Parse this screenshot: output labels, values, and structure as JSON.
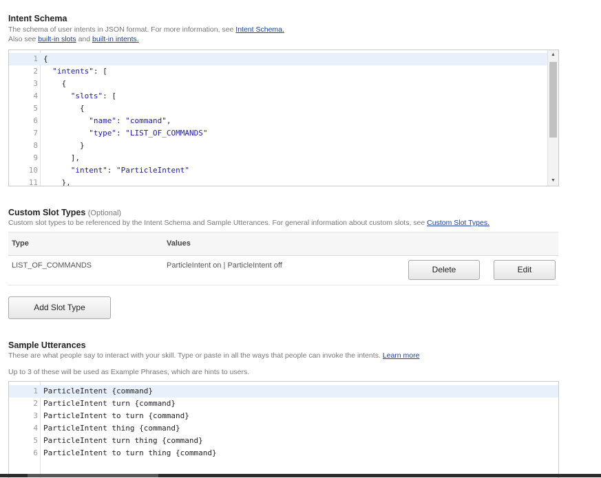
{
  "intent_schema": {
    "title": "Intent Schema",
    "desc_line1_prefix": "The schema of user intents in JSON format. For more information, see ",
    "desc_link1": "Intent Schema.",
    "desc_line2_prefix": "Also see ",
    "desc_link2": "built-in slots",
    "desc_and": " and ",
    "desc_link3": "built-in intents.",
    "editor_lines": [
      {
        "n": "1",
        "parts": [
          [
            "p",
            "{"
          ]
        ]
      },
      {
        "n": "2",
        "parts": [
          [
            "p",
            "  "
          ],
          [
            "s",
            "\"intents\""
          ],
          [
            "p",
            ": ["
          ]
        ]
      },
      {
        "n": "3",
        "parts": [
          [
            "p",
            "    {"
          ]
        ]
      },
      {
        "n": "4",
        "parts": [
          [
            "p",
            "      "
          ],
          [
            "s",
            "\"slots\""
          ],
          [
            "p",
            ": ["
          ]
        ]
      },
      {
        "n": "5",
        "parts": [
          [
            "p",
            "        {"
          ]
        ]
      },
      {
        "n": "6",
        "parts": [
          [
            "p",
            "          "
          ],
          [
            "s",
            "\"name\""
          ],
          [
            "p",
            ": "
          ],
          [
            "s",
            "\"command\""
          ],
          [
            "p",
            ","
          ]
        ]
      },
      {
        "n": "7",
        "parts": [
          [
            "p",
            "          "
          ],
          [
            "s",
            "\"type\""
          ],
          [
            "p",
            ": "
          ],
          [
            "s",
            "\"LIST_OF_COMMANDS\""
          ]
        ]
      },
      {
        "n": "8",
        "parts": [
          [
            "p",
            "        }"
          ]
        ]
      },
      {
        "n": "9",
        "parts": [
          [
            "p",
            "      ],"
          ]
        ]
      },
      {
        "n": "10",
        "parts": [
          [
            "p",
            "      "
          ],
          [
            "s",
            "\"intent\""
          ],
          [
            "p",
            ": "
          ],
          [
            "s",
            "\"ParticleIntent\""
          ]
        ]
      },
      {
        "n": "11",
        "parts": [
          [
            "p",
            "    },"
          ]
        ]
      }
    ]
  },
  "custom_slot_types": {
    "title": "Custom Slot Types",
    "optional": "(Optional)",
    "desc_prefix": "Custom slot types to be referenced by the Intent Schema and Sample Utterances. For general information about custom slots, see ",
    "desc_link": "Custom Slot Types.",
    "columns": {
      "type": "Type",
      "values": "Values"
    },
    "rows": [
      {
        "type": "LIST_OF_COMMANDS",
        "values": "ParticleIntent on | ParticleIntent off",
        "delete_label": "Delete",
        "edit_label": "Edit"
      }
    ],
    "add_button": "Add Slot Type"
  },
  "sample_utterances": {
    "title": "Sample Utterances",
    "desc_prefix": "These are what people say to interact with your skill. Type or paste in all the ways that people can invoke the intents. ",
    "desc_link": "Learn more",
    "note": "Up to 3 of these will be used as Example Phrases, which are hints to users.",
    "lines": [
      {
        "n": "1",
        "text": "ParticleIntent {command}"
      },
      {
        "n": "2",
        "text": "ParticleIntent turn {command}"
      },
      {
        "n": "3",
        "text": "ParticleIntent to turn {command}"
      },
      {
        "n": "4",
        "text": "ParticleIntent thing {command}"
      },
      {
        "n": "5",
        "text": "ParticleIntent turn thing {command}"
      },
      {
        "n": "6",
        "text": "ParticleIntent to turn thing {command}"
      }
    ]
  },
  "colors": {
    "link": "#1a3c9c",
    "string": "#1a1aa6",
    "active_line": "#e8f1fb"
  },
  "icons": {
    "scroll_up": "triangle-up-icon",
    "scroll_down": "triangle-down-icon"
  }
}
